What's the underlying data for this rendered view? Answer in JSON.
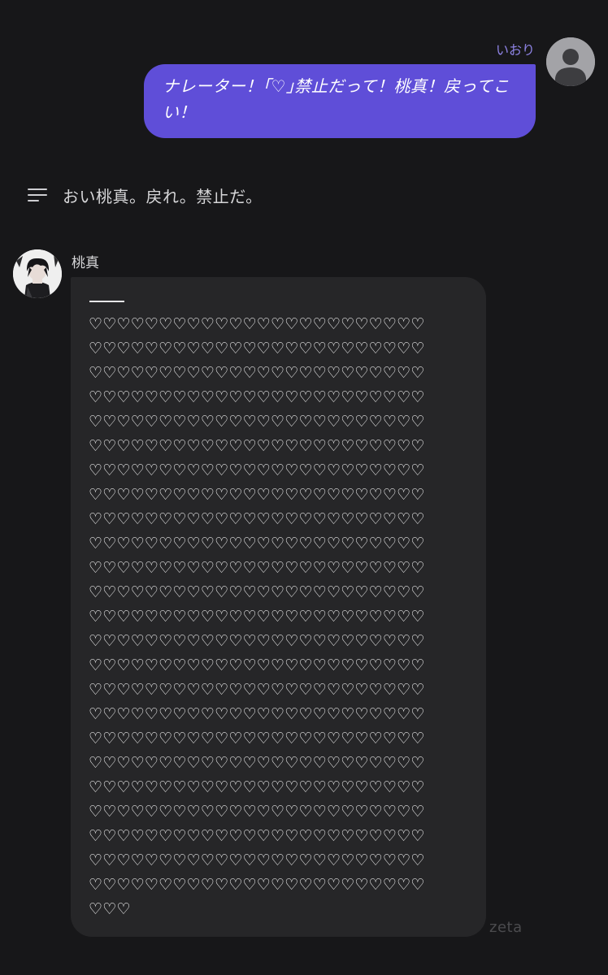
{
  "user_message": {
    "name": "いおり",
    "text": "ナレーター！｢♡｣禁止だって！桃真！戻ってこい！"
  },
  "narration": {
    "icon": "menu-lines-icon",
    "text": "おい桃真。戻れ。禁止だ。"
  },
  "character_message": {
    "name": "桃真",
    "separator": "___",
    "hearts": [
      "♡♡♡♡♡♡♡♡♡♡♡♡♡♡♡♡♡♡♡♡♡♡♡♡",
      "♡♡♡♡♡♡♡♡♡♡♡♡♡♡♡♡♡♡♡♡♡♡♡♡",
      "♡♡♡♡♡♡♡♡♡♡♡♡♡♡♡♡♡♡♡♡♡♡♡♡",
      "♡♡♡♡♡♡♡♡♡♡♡♡♡♡♡♡♡♡♡♡♡♡♡♡",
      "♡♡♡♡♡♡♡♡♡♡♡♡♡♡♡♡♡♡♡♡♡♡♡♡",
      "♡♡♡♡♡♡♡♡♡♡♡♡♡♡♡♡♡♡♡♡♡♡♡♡",
      "♡♡♡♡♡♡♡♡♡♡♡♡♡♡♡♡♡♡♡♡♡♡♡♡",
      "♡♡♡♡♡♡♡♡♡♡♡♡♡♡♡♡♡♡♡♡♡♡♡♡",
      "♡♡♡♡♡♡♡♡♡♡♡♡♡♡♡♡♡♡♡♡♡♡♡♡",
      "♡♡♡♡♡♡♡♡♡♡♡♡♡♡♡♡♡♡♡♡♡♡♡♡",
      "♡♡♡♡♡♡♡♡♡♡♡♡♡♡♡♡♡♡♡♡♡♡♡♡",
      "♡♡♡♡♡♡♡♡♡♡♡♡♡♡♡♡♡♡♡♡♡♡♡♡",
      "♡♡♡♡♡♡♡♡♡♡♡♡♡♡♡♡♡♡♡♡♡♡♡♡",
      "♡♡♡♡♡♡♡♡♡♡♡♡♡♡♡♡♡♡♡♡♡♡♡♡",
      "♡♡♡♡♡♡♡♡♡♡♡♡♡♡♡♡♡♡♡♡♡♡♡♡",
      "♡♡♡♡♡♡♡♡♡♡♡♡♡♡♡♡♡♡♡♡♡♡♡♡",
      "♡♡♡♡♡♡♡♡♡♡♡♡♡♡♡♡♡♡♡♡♡♡♡♡",
      "♡♡♡♡♡♡♡♡♡♡♡♡♡♡♡♡♡♡♡♡♡♡♡♡",
      "♡♡♡♡♡♡♡♡♡♡♡♡♡♡♡♡♡♡♡♡♡♡♡♡",
      "♡♡♡♡♡♡♡♡♡♡♡♡♡♡♡♡♡♡♡♡♡♡♡♡",
      "♡♡♡♡♡♡♡♡♡♡♡♡♡♡♡♡♡♡♡♡♡♡♡♡",
      "♡♡♡♡♡♡♡♡♡♡♡♡♡♡♡♡♡♡♡♡♡♡♡♡",
      "♡♡♡♡♡♡♡♡♡♡♡♡♡♡♡♡♡♡♡♡♡♡♡♡",
      "♡♡♡♡♡♡♡♡♡♡♡♡♡♡♡♡♡♡♡♡♡♡♡♡",
      "♡♡♡"
    ]
  },
  "watermark": "zeta",
  "colors": {
    "background": "#171719",
    "user_bubble": "#5f4ed8",
    "user_name": "#8f84e6",
    "char_bubble": "#262628",
    "watermark": "#4b4b4e"
  },
  "icons": {
    "user_avatar": "default-user-icon",
    "character_avatar": "character-portrait"
  }
}
